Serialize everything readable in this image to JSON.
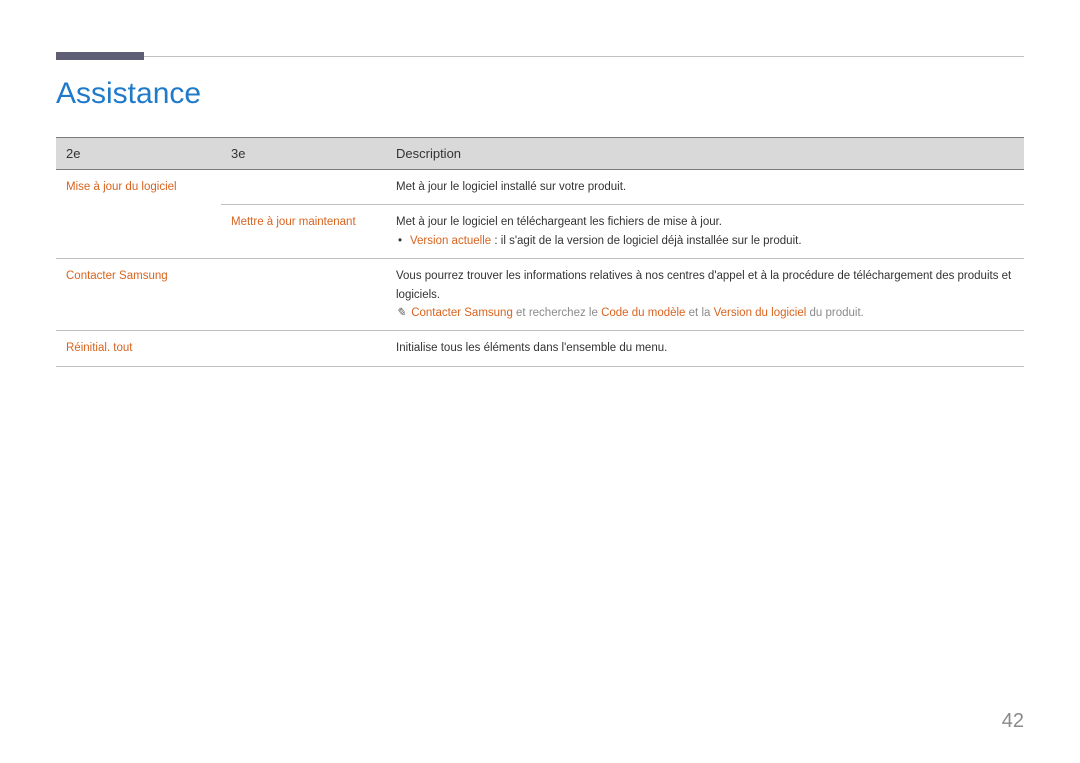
{
  "title": "Assistance",
  "pageNumber": "42",
  "headers": {
    "col1": "2e",
    "col2": "3e",
    "col3": "Description"
  },
  "rows": {
    "r1": {
      "c1": "Mise à jour du logiciel",
      "c2": "",
      "c3": "Met à jour le logiciel installé sur votre produit."
    },
    "r2": {
      "c1": "",
      "c2": "Mettre à jour maintenant",
      "c3_line1": "Met à jour le logiciel en téléchargeant les fichiers de mise à jour.",
      "c3_bullet_bold": "Version actuelle",
      "c3_bullet_rest": " : il s'agit de la version de logiciel déjà installée sur le produit."
    },
    "r3": {
      "c1": "Contacter Samsung",
      "c2": "",
      "c3_line1": "Vous pourrez trouver les informations relatives à nos centres d'appel et à la procédure de téléchargement des produits et logiciels.",
      "c3_note_part1": "Contacter Samsung",
      "c3_note_gray1": " et recherchez le ",
      "c3_note_part2": "Code du modèle",
      "c3_note_gray2": " et la ",
      "c3_note_part3": "Version du logiciel",
      "c3_note_gray3": " du produit."
    },
    "r4": {
      "c1": "Réinitial. tout",
      "c2": "",
      "c3": "Initialise tous les éléments dans l'ensemble du menu."
    }
  }
}
